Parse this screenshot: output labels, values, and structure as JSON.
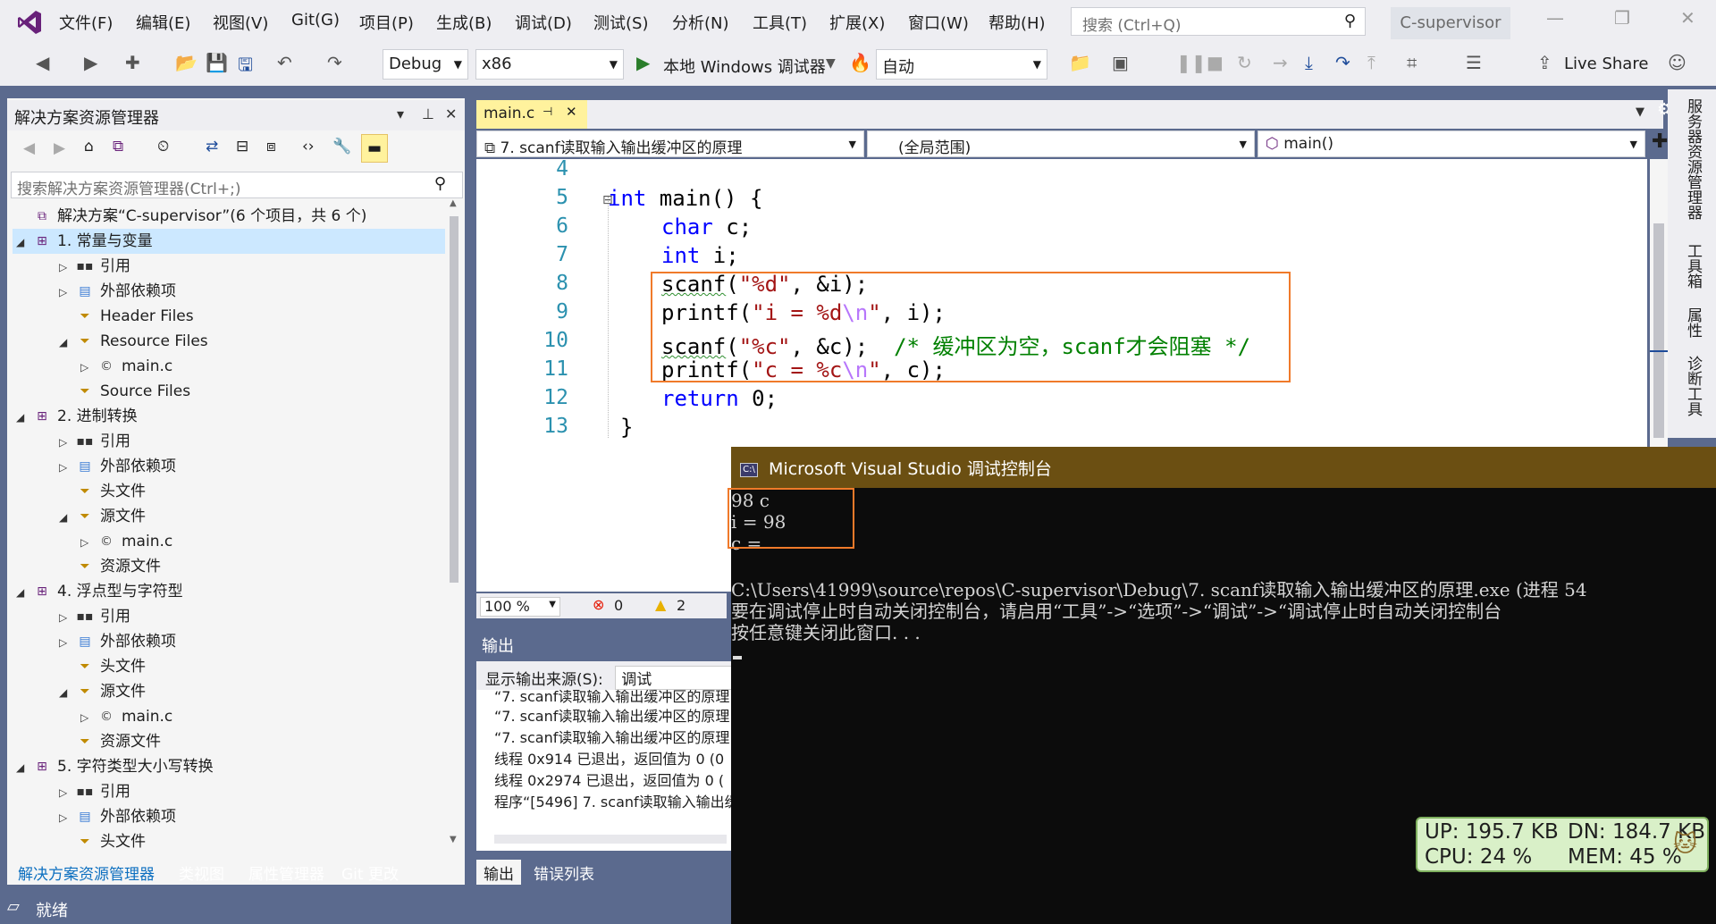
{
  "menu": {
    "items": [
      "文件(F)",
      "编辑(E)",
      "视图(V)",
      "Git(G)",
      "项目(P)",
      "生成(B)",
      "调试(D)",
      "测试(S)",
      "分析(N)",
      "工具(T)",
      "扩展(X)",
      "窗口(W)",
      "帮助(H)"
    ],
    "search_placeholder": "搜索 (Ctrl+Q)",
    "project_name": "C-supervisor"
  },
  "toolbar": {
    "config": "Debug",
    "platform": "x86",
    "run_label": "本地 Windows 调试器",
    "auto": "自动",
    "live_share": "Live Share"
  },
  "solution_explorer": {
    "title": "解决方案资源管理器",
    "search_placeholder": "搜索解决方案资源管理器(Ctrl+;)",
    "rows": [
      {
        "label": "解决方案“C-supervisor”(6 个项目，共 6 个)",
        "indent": 0,
        "exp": "",
        "icon": "solution"
      },
      {
        "label": "1. 常量与变量",
        "indent": 0,
        "exp": "open",
        "icon": "project",
        "selected": true
      },
      {
        "label": "引用",
        "indent": 1,
        "exp": "closed",
        "icon": "ref"
      },
      {
        "label": "外部依赖项",
        "indent": 1,
        "exp": "closed",
        "icon": "extdep"
      },
      {
        "label": "Header Files",
        "indent": 1,
        "exp": "",
        "icon": "filter"
      },
      {
        "label": "Resource Files",
        "indent": 1,
        "exp": "open",
        "icon": "filter"
      },
      {
        "label": "main.c",
        "indent": 2,
        "exp": "closed",
        "icon": "cfile"
      },
      {
        "label": "Source Files",
        "indent": 1,
        "exp": "",
        "icon": "filter"
      },
      {
        "label": "2. 进制转换",
        "indent": 0,
        "exp": "open",
        "icon": "project"
      },
      {
        "label": "引用",
        "indent": 1,
        "exp": "closed",
        "icon": "ref"
      },
      {
        "label": "外部依赖项",
        "indent": 1,
        "exp": "closed",
        "icon": "extdep"
      },
      {
        "label": "头文件",
        "indent": 1,
        "exp": "",
        "icon": "filter"
      },
      {
        "label": "源文件",
        "indent": 1,
        "exp": "open",
        "icon": "filter"
      },
      {
        "label": "main.c",
        "indent": 2,
        "exp": "closed",
        "icon": "cfile"
      },
      {
        "label": "资源文件",
        "indent": 1,
        "exp": "",
        "icon": "filter"
      },
      {
        "label": "4. 浮点型与字符型",
        "indent": 0,
        "exp": "open",
        "icon": "project"
      },
      {
        "label": "引用",
        "indent": 1,
        "exp": "closed",
        "icon": "ref"
      },
      {
        "label": "外部依赖项",
        "indent": 1,
        "exp": "closed",
        "icon": "extdep"
      },
      {
        "label": "头文件",
        "indent": 1,
        "exp": "",
        "icon": "filter"
      },
      {
        "label": "源文件",
        "indent": 1,
        "exp": "open",
        "icon": "filter"
      },
      {
        "label": "main.c",
        "indent": 2,
        "exp": "closed",
        "icon": "cfile"
      },
      {
        "label": "资源文件",
        "indent": 1,
        "exp": "",
        "icon": "filter"
      },
      {
        "label": "5. 字符类型大小写转换",
        "indent": 0,
        "exp": "open",
        "icon": "project"
      },
      {
        "label": "引用",
        "indent": 1,
        "exp": "closed",
        "icon": "ref"
      },
      {
        "label": "外部依赖项",
        "indent": 1,
        "exp": "closed",
        "icon": "extdep"
      },
      {
        "label": "头文件",
        "indent": 1,
        "exp": "",
        "icon": "filter"
      }
    ],
    "bottom_tabs": [
      "解决方案资源管理器",
      "类视图",
      "属性管理器",
      "Git 更改"
    ]
  },
  "editor": {
    "tab_label": "main.c",
    "nav_file": "7. scanf读取输入输出缓冲区的原理",
    "nav_scope": "(全局范围)",
    "nav_func": "main()",
    "line_numbers": [
      "4",
      "5",
      "6",
      "7",
      "8",
      "9",
      "10",
      "11",
      "12",
      "13"
    ],
    "zoom": "100 %",
    "errors": "0",
    "warnings": "2"
  },
  "output": {
    "title": "输出",
    "source_label": "显示输出来源(S):",
    "source_value": "调试",
    "lines": [
      "“7. scanf读取输入输出缓冲区的原理",
      "“7. scanf读取输入输出缓冲区的原理",
      "“7. scanf读取输入输出缓冲区的原理",
      "线程 0x914 已退出，返回值为 0 (0",
      "线程 0x2974 已退出，返回值为 0 (",
      "程序“[5496] 7. scanf读取输入输出缓"
    ],
    "tabs": [
      "输出",
      "错误列表"
    ]
  },
  "right_strip": [
    "服务器资源管理器",
    "工具箱",
    "属性",
    "诊断工具"
  ],
  "console": {
    "title": "Microsoft Visual Studio 调试控制台",
    "lines": [
      "98 c",
      "i = 98",
      "c =",
      "",
      "C:\\Users\\41999\\source\\repos\\C-supervisor\\Debug\\7. scanf读取输入输出缓冲区的原理.exe (进程 54",
      "要在调试停止时自动关闭控制台，请启用“工具”->“选项”->“调试”->“调试停止时自动关闭控制台",
      "按任意键关闭此窗口. . ."
    ]
  },
  "netmon": {
    "up": "UP: 195.7 KB",
    "dn": "DN: 184.7 KB",
    "cpu": "CPU: 24 %",
    "mem": "MEM: 45 %"
  },
  "status": {
    "text": "就绪"
  }
}
